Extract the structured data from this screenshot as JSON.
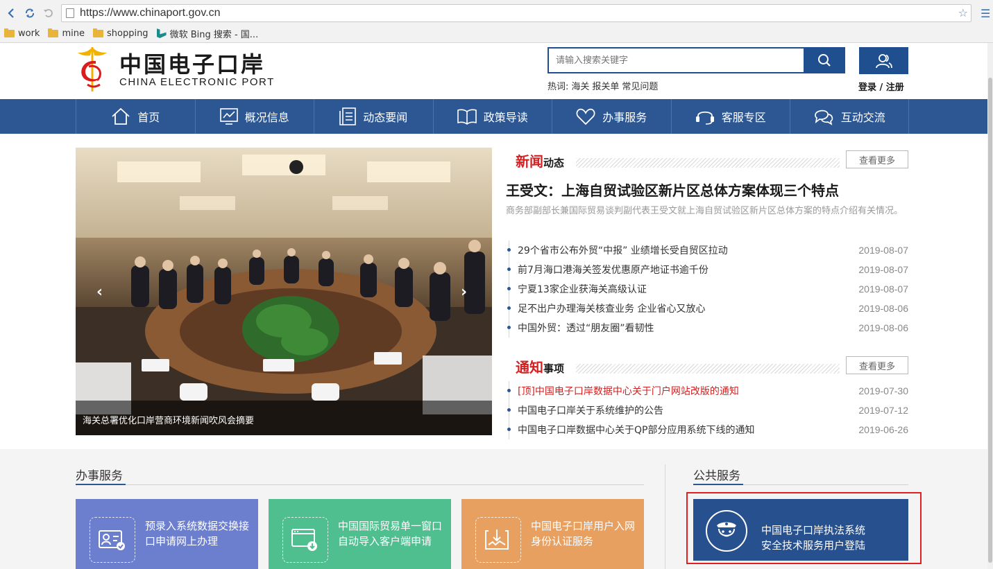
{
  "browser": {
    "url": "https://www.chinaport.gov.cn",
    "bookmarks": [
      {
        "label": "work",
        "icon": "folder-icon"
      },
      {
        "label": "mine",
        "icon": "folder-icon"
      },
      {
        "label": "shopping",
        "icon": "folder-icon"
      },
      {
        "label": "微软 Bing 搜索 - 国...",
        "icon": "bing-icon"
      }
    ]
  },
  "header": {
    "logo_cn": "中国电子口岸",
    "logo_en": "CHINA ELECTRONIC PORT",
    "search_placeholder": "请输入搜索关键字",
    "hot_label": "热词:",
    "hot_words": [
      "海关",
      "报关单",
      "常见问题"
    ],
    "login_label": "登录 / 注册"
  },
  "nav": [
    {
      "label": "首页",
      "icon": "home-icon"
    },
    {
      "label": "概况信息",
      "icon": "chart-icon"
    },
    {
      "label": "动态要闻",
      "icon": "document-icon"
    },
    {
      "label": "政策导读",
      "icon": "book-icon"
    },
    {
      "label": "办事服务",
      "icon": "heart-icon"
    },
    {
      "label": "客服专区",
      "icon": "headset-icon"
    },
    {
      "label": "互动交流",
      "icon": "chat-icon"
    }
  ],
  "carousel": {
    "caption": "海关总署优化口岸营商环境新闻吹风会摘要"
  },
  "news": {
    "title_red": "新闻",
    "title_dark": "动态",
    "more_label": "查看更多",
    "headline": "王受文：上海自贸试验区新片区总体方案体现三个特点",
    "summary": "商务部副部长兼国际贸易谈判副代表王受文就上海自贸试验区新片区总体方案的特点介绍有关情况。",
    "items": [
      {
        "title": "29个省市公布外贸“中报” 业绩增长受自贸区拉动",
        "date": "2019-08-07"
      },
      {
        "title": "前7月海口港海关签发优惠原产地证书逾千份",
        "date": "2019-08-07"
      },
      {
        "title": "宁夏13家企业获海关高级认证",
        "date": "2019-08-07"
      },
      {
        "title": "足不出户办理海关核查业务 企业省心又放心",
        "date": "2019-08-06"
      },
      {
        "title": "中国外贸：透过“朋友圈”看韧性",
        "date": "2019-08-06"
      }
    ]
  },
  "notice": {
    "title_red": "通知",
    "title_dark": "事项",
    "more_label": "查看更多",
    "items": [
      {
        "title": "[顶]中国电子口岸数据中心关于门户网站改版的通知",
        "date": "2019-07-30",
        "highlight": true
      },
      {
        "title": "中国电子口岸关于系统维护的公告",
        "date": "2019-07-12",
        "highlight": false
      },
      {
        "title": "中国电子口岸数据中心关于QP部分应用系统下线的通知",
        "date": "2019-06-26",
        "highlight": false
      }
    ]
  },
  "services": {
    "title": "办事服务",
    "cards": [
      {
        "label": "预录入系统数据交换接口申请网上办理",
        "color": "#6c7fcf",
        "icon": "id-card-icon"
      },
      {
        "label": "中国国际贸易单一窗口自动导入客户端申请",
        "color": "#4fbf8f",
        "icon": "download-window-icon"
      },
      {
        "label": "中国电子口岸用户入网身份认证服务",
        "color": "#e8a060",
        "icon": "certificate-icon"
      }
    ]
  },
  "public": {
    "title": "公共服务",
    "card_line1": "中国电子口岸执法系统",
    "card_line2": "安全技术服务用户登陆",
    "icon": "police-icon"
  },
  "colors": {
    "brand_blue": "#2d5793",
    "accent_red": "#d32020",
    "highlight_box": "#e02020"
  }
}
